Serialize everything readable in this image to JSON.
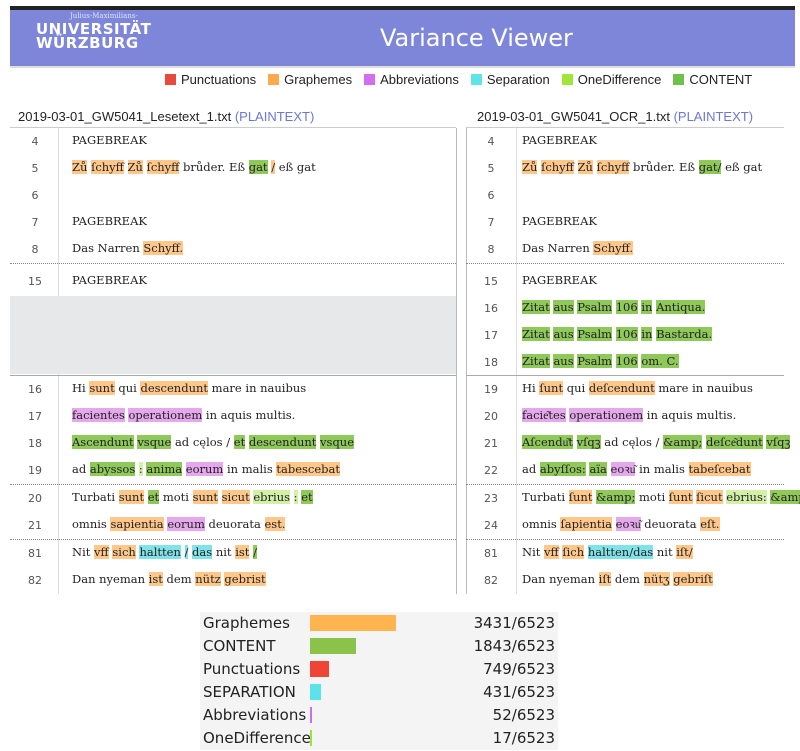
{
  "header": {
    "logo_small": "Julius-Maximilians-",
    "logo_line1": "UNIVERSITÄT",
    "logo_line2": "WÜRZBURG",
    "title": "Variance Viewer"
  },
  "legend": [
    {
      "label": "Punctuations",
      "color": "#e84a3c"
    },
    {
      "label": "Graphemes",
      "color": "#ffa94d"
    },
    {
      "label": "Abbreviations",
      "color": "#d46ef0"
    },
    {
      "label": "Separation",
      "color": "#5fe4e8"
    },
    {
      "label": "OneDifference",
      "color": "#9fe53a"
    },
    {
      "label": "CONTENT",
      "color": "#6ec14a"
    }
  ],
  "left_file": {
    "name": "2019-03-01_GW5041_Lesetext_1.txt",
    "format": "(PLAINTEXT)"
  },
  "right_file": {
    "name": "2019-03-01_GW5041_OCR_1.txt",
    "format": "(PLAINTEXT)"
  },
  "left_rows": [
    {
      "num": "4"
    },
    {
      "num": "5"
    },
    {
      "num": "6"
    },
    {
      "num": "7"
    },
    {
      "num": "8"
    },
    {
      "num": "15"
    },
    {
      "num": "16"
    },
    {
      "num": "17"
    },
    {
      "num": "18"
    },
    {
      "num": "19"
    },
    {
      "num": "20"
    },
    {
      "num": "21"
    },
    {
      "num": "81"
    },
    {
      "num": "82"
    }
  ],
  "right_rows": [
    {
      "num": "4"
    },
    {
      "num": "5"
    },
    {
      "num": "6"
    },
    {
      "num": "7"
    },
    {
      "num": "8"
    },
    {
      "num": "15"
    },
    {
      "num": "16"
    },
    {
      "num": "17"
    },
    {
      "num": "18"
    },
    {
      "num": "19"
    },
    {
      "num": "20"
    },
    {
      "num": "21"
    },
    {
      "num": "22"
    },
    {
      "num": "23"
    },
    {
      "num": "24"
    },
    {
      "num": "81"
    },
    {
      "num": "82"
    }
  ],
  "text": {
    "pagebreak": "PAGEBREAK",
    "l5": [
      "Zů",
      "ſchyff",
      "Zů",
      "ſchyff",
      "brůder. Eß",
      "gat",
      "/",
      "eß gat"
    ],
    "r5": [
      "Zů",
      "ſchyff",
      "Zů",
      "ſchyff",
      "brůder. Eß",
      "gat/",
      "eß gat"
    ],
    "l8": [
      "Das Narren ",
      "Schyff."
    ],
    "r8": [
      "Das Narren ",
      "Schyff."
    ],
    "r16": [
      "Zitat",
      "aus",
      "Psalm",
      "106",
      "in",
      "Antiqua."
    ],
    "r17": [
      "Zitat",
      "aus",
      "Psalm",
      "106",
      "in",
      "Bastarda."
    ],
    "r18": [
      "Zitat",
      "aus",
      "Psalm",
      "106",
      "om. C."
    ],
    "l16": [
      "Hi ",
      "sunt",
      " qui ",
      "descendunt",
      " mare in nauibus"
    ],
    "r19": [
      "Hi ",
      "ſunt",
      " qui ",
      "deſcendunt",
      " mare in nauibus"
    ],
    "l17": [
      "facientes",
      " ",
      "operationem",
      " in aquis multis."
    ],
    "r20": [
      "facie͂tes",
      " ",
      "operationem",
      " in aquis multis."
    ],
    "l18": [
      "Ascendunt",
      " ",
      "vsque",
      " ad cęlos / ",
      "et",
      " ",
      "descendunt",
      " ",
      "vsque"
    ],
    "r21": [
      "Aſcendu͂t",
      " ",
      "vſqꝫ",
      " ad cęlos / ",
      "&amp;",
      " ",
      "deſce͂dunt",
      " ",
      "vſqꝫ"
    ],
    "l19": [
      "ad ",
      "abyssos",
      " ",
      ":",
      " ",
      "anima",
      " ",
      "eorum",
      " in malis ",
      "tabescebat"
    ],
    "r22": [
      "ad ",
      "abyſſos:",
      " ",
      "aïa",
      " ",
      "eoꝛu͂",
      " in malis ",
      "tabeſcebat"
    ],
    "l20": [
      "Turbati ",
      "sunt",
      " ",
      "et",
      " moti ",
      "sunt",
      " ",
      "sicut",
      " ",
      "ebrius",
      " ",
      ":",
      " ",
      "et"
    ],
    "r23": [
      "Turbati ",
      "ſunt",
      " ",
      "&amp;",
      " moti ",
      "ſunt",
      " ",
      "ſicut",
      " ",
      "ebrius:",
      " ",
      "&amp;"
    ],
    "l21": [
      "omnis ",
      "sapientia",
      " ",
      "eorum",
      " deuorata ",
      "est."
    ],
    "r24": [
      "omnis ",
      "ſapientia",
      " ",
      "eoꝛu͂",
      " deuorata ",
      "eſt."
    ],
    "l81": [
      "Nit ",
      "vff",
      " ",
      "sich",
      " ",
      "haltten",
      " ",
      "/",
      " ",
      "das",
      " nit ",
      "ist",
      " ",
      "/"
    ],
    "r81": [
      "Nit ",
      "vff",
      " ",
      "ſich",
      " ",
      "haltten/das",
      " nit ",
      "iſt/"
    ],
    "l82": [
      "Dan nyeman ",
      "ist",
      " dem ",
      "nütz",
      " ",
      "gebrist"
    ],
    "r82": [
      "Dan nyeman ",
      "iſt",
      " dem ",
      "nütʒ",
      " ",
      "gebriſt"
    ]
  },
  "stats": [
    {
      "label": "Graphemes",
      "count": "3431/6523",
      "value": 3431,
      "total": 6523,
      "color": "#ffb44f"
    },
    {
      "label": "CONTENT",
      "count": "1843/6523",
      "value": 1843,
      "total": 6523,
      "color": "#8bc34a"
    },
    {
      "label": "Punctuations",
      "count": "749/6523",
      "value": 749,
      "total": 6523,
      "color": "#ee4537"
    },
    {
      "label": "SEPARATION",
      "count": "431/6523",
      "value": 431,
      "total": 6523,
      "color": "#59e3ea"
    },
    {
      "label": "Abbreviations",
      "count": "52/6523",
      "value": 52,
      "total": 6523,
      "color": "#cc6ee6"
    },
    {
      "label": "OneDifference",
      "count": "17/6523",
      "value": 17,
      "total": 6523,
      "color": "#9de23b"
    }
  ]
}
